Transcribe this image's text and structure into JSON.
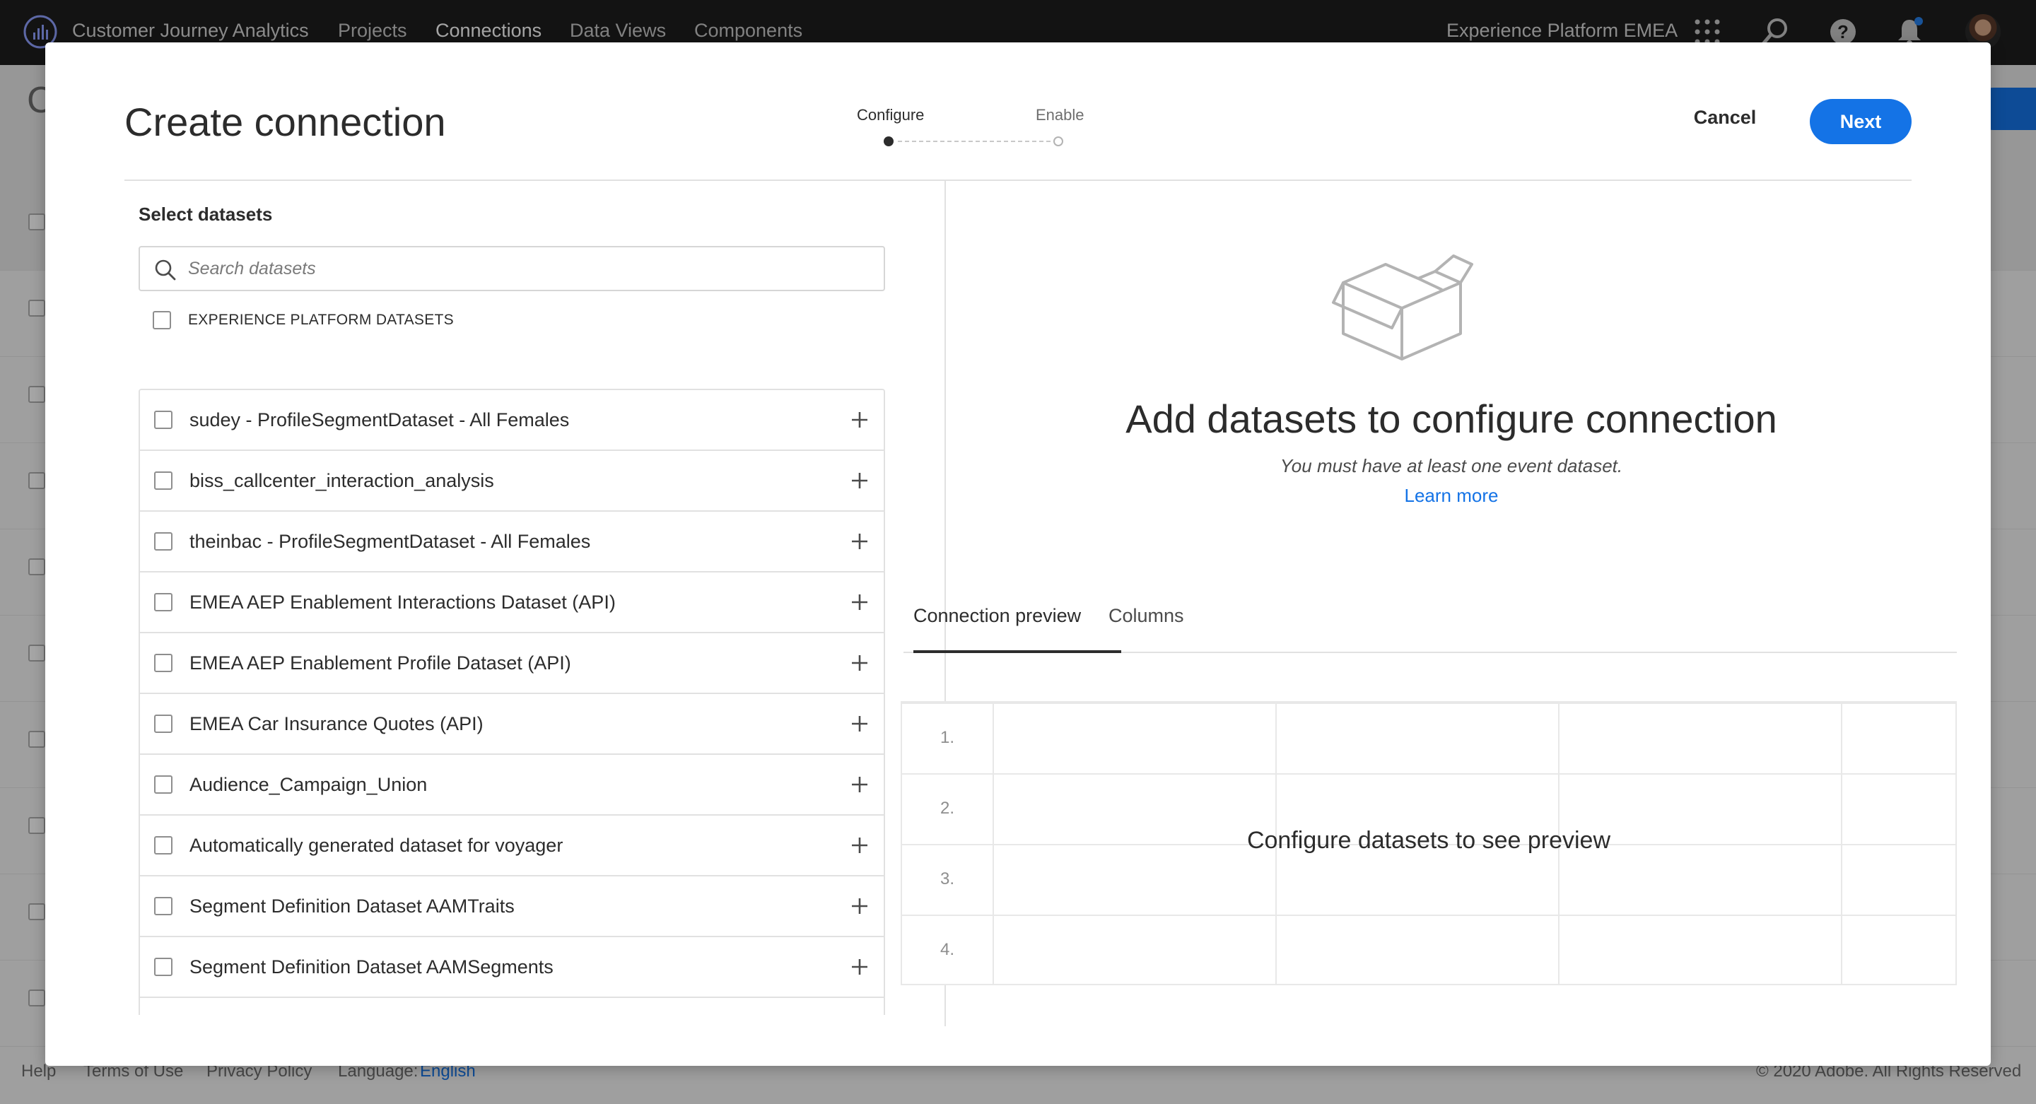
{
  "topnav": {
    "app_title": "Customer Journey Analytics",
    "links": [
      "Projects",
      "Connections",
      "Data Views",
      "Components"
    ],
    "active_link": "Connections",
    "org_name": "Experience Platform EMEA"
  },
  "background": {
    "footer": {
      "help": "Help",
      "terms": "Terms of Use",
      "privacy": "Privacy Policy",
      "language_label": "Language:",
      "language_value": "English",
      "copyright": "© 2020 Adobe. All Rights Reserved"
    }
  },
  "modal": {
    "title": "Create connection",
    "steps": [
      {
        "label": "Configure",
        "state": "current"
      },
      {
        "label": "Enable",
        "state": "pending"
      }
    ],
    "cancel_label": "Cancel",
    "next_label": "Next",
    "left": {
      "section_label": "Select datasets",
      "search_placeholder": "Search datasets",
      "select_all_label": "EXPERIENCE PLATFORM DATASETS",
      "datasets": [
        "sudey - ProfileSegmentDataset - All Females",
        "biss_callcenter_interaction_analysis",
        "theinbac - ProfileSegmentDataset - All Females",
        "EMEA AEP Enablement Interactions Dataset (API)",
        "EMEA AEP Enablement Profile Dataset (API)",
        "EMEA Car Insurance Quotes (API)",
        "Audience_Campaign_Union",
        "Automatically generated dataset for voyager",
        "Segment Definition Dataset AAMTraits",
        "Segment Definition Dataset AAMSegments"
      ]
    },
    "right": {
      "empty_title": "Add datasets to configure connection",
      "empty_subtitle": "You must have at least one event dataset.",
      "learn_more": "Learn more",
      "tabs": [
        "Connection preview",
        "Columns"
      ],
      "active_tab": "Connection preview",
      "row_numbers": [
        "1.",
        "2.",
        "3.",
        "4."
      ],
      "preview_message": "Configure datasets to see preview"
    }
  },
  "colors": {
    "accent": "#1473e6",
    "nav_bg": "#1e1e1e"
  }
}
